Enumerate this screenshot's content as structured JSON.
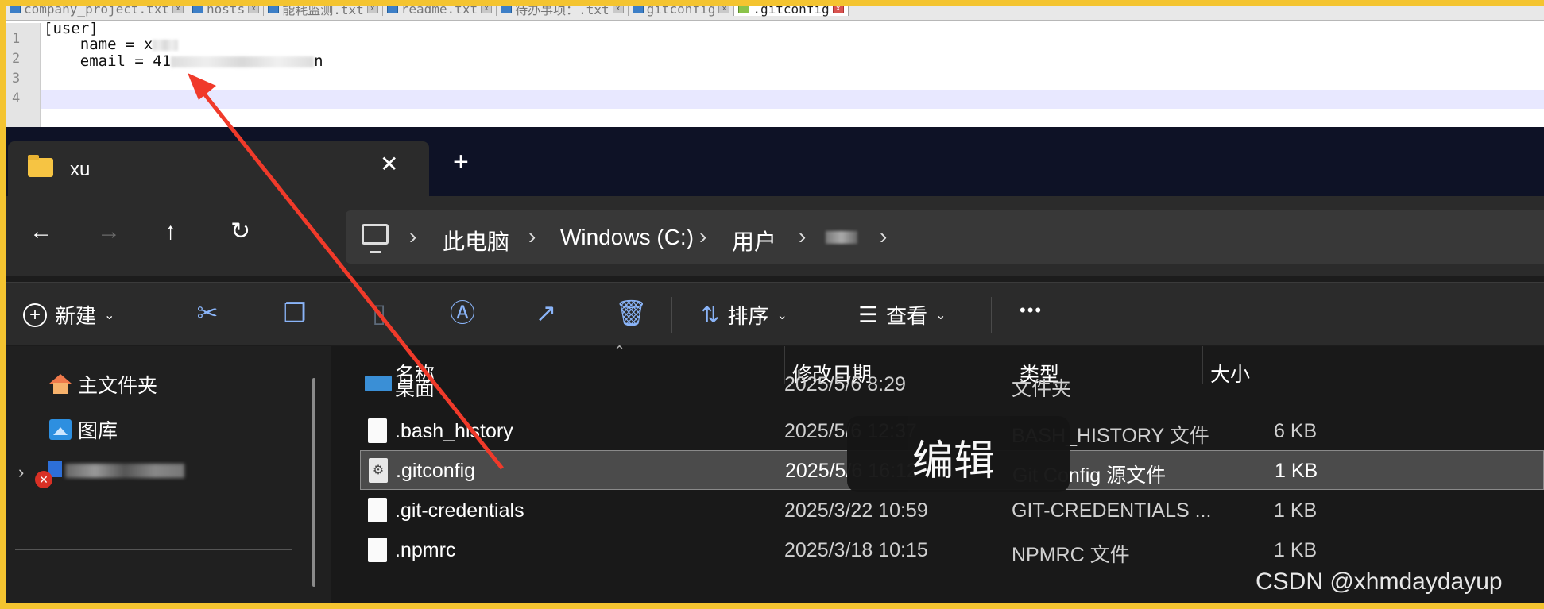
{
  "editor": {
    "tabs": [
      {
        "label": "company_project.txt"
      },
      {
        "label": "hosts"
      },
      {
        "label": "能耗监测.txt"
      },
      {
        "label": "readme.txt"
      },
      {
        "label": "待办事项：.txt"
      },
      {
        "label": "gitconfig"
      },
      {
        "label": ".gitconfig",
        "active": true
      }
    ],
    "line_numbers": [
      "1",
      "2",
      "3",
      "4"
    ],
    "lines": [
      "[user]",
      "    name = x",
      "    email = 41",
      ""
    ],
    "email_tail": "n"
  },
  "explorer": {
    "tab_title": "xu",
    "close_glyph": "✕",
    "new_tab_glyph": "+",
    "nav": {
      "back": "←",
      "forward": "→",
      "up": "↑",
      "refresh": "↻"
    },
    "breadcrumb": [
      "此电脑",
      "Windows (C:)",
      "用户"
    ],
    "crumb_sep": "›",
    "toolbar": {
      "new_label": "新建",
      "sort_label": "排序",
      "view_label": "查看",
      "more": "•••"
    },
    "sidebar": [
      {
        "label": "主文件夹",
        "icon": "home-icon"
      },
      {
        "label": "图库",
        "icon": "gallery-icon"
      }
    ],
    "columns": {
      "name": "名称",
      "modified": "修改日期",
      "type": "类型",
      "size": "大小"
    },
    "files": [
      {
        "name": "桌面",
        "modified": "2025/5/6 8:29",
        "type": "文件夹",
        "size": ""
      },
      {
        "name": ".bash_history",
        "modified": "2025/5/6 12:37",
        "type": "BASH_HISTORY 文件",
        "size": "6 KB"
      },
      {
        "name": ".gitconfig",
        "modified": "2025/5/6 16:12",
        "type": "Git Config 源文件",
        "size": "1 KB",
        "selected": true
      },
      {
        "name": ".git-credentials",
        "modified": "2025/3/22 10:59",
        "type": "GIT-CREDENTIALS ...",
        "size": "1 KB"
      },
      {
        "name": ".npmrc",
        "modified": "2025/3/18 10:15",
        "type": "NPMRC 文件",
        "size": "1 KB"
      }
    ],
    "tooltip": "编辑"
  },
  "annotation": {
    "arrow_color": "#f03a2a"
  },
  "frame_color": "#f4c430",
  "watermark": "CSDN @xhmdaydayup"
}
